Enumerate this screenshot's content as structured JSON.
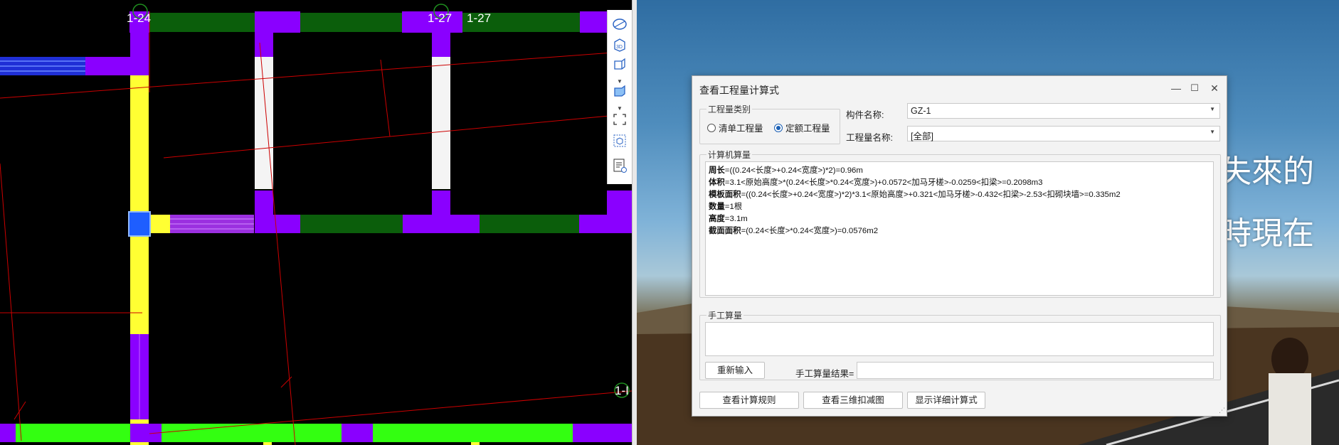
{
  "cad": {
    "axis_labels": [
      "1-24",
      "1-27",
      "1-27",
      "1-I"
    ]
  },
  "toolbar": {
    "icons": [
      "orbit-icon",
      "view-3d-icon",
      "box-view-icon",
      "box-solid-icon",
      "fit-view-icon",
      "component-icon",
      "properties-icon"
    ],
    "label_3d": "3D"
  },
  "wallpaper": {
    "text_line1": "失來的",
    "text_line2": "時現在"
  },
  "dialog": {
    "title": "查看工程量计算式",
    "window_buttons": {
      "minimize": "—",
      "maximize": "☐",
      "close": "✕"
    },
    "quantity_type": {
      "legend": "工程量类别",
      "options": [
        {
          "label": "清单工程量",
          "selected": false
        },
        {
          "label": "定额工程量",
          "selected": true
        }
      ]
    },
    "component_name": {
      "label": "构件名称:",
      "value": "GZ-1"
    },
    "quantity_name": {
      "label": "工程量名称:",
      "value": "[全部]"
    },
    "computer_calc": {
      "legend": "计算机算量",
      "lines": [
        {
          "key": "周长",
          "expr": "=((0.24<长度>+0.24<宽度>)*2)=0.96m"
        },
        {
          "key": "体积",
          "expr": "=3.1<原始高度>*(0.24<长度>*0.24<宽度>)+0.0572<加马牙槎>-0.0259<扣梁>=0.2098m3"
        },
        {
          "key": "模板面积",
          "expr": "=((0.24<长度>+0.24<宽度>)*2)*3.1<原始高度>+0.321<加马牙槎>-0.432<扣梁>-2.53<扣砌块墙>=0.335m2"
        },
        {
          "key": "数量",
          "expr": "=1根"
        },
        {
          "key": "高度",
          "expr": "=3.1m"
        },
        {
          "key": "截面面积",
          "expr": "=(0.24<长度>*0.24<宽度>)=0.0576m2"
        }
      ]
    },
    "manual_calc": {
      "legend": "手工算量",
      "reenter_button": "重新输入",
      "result_label": "手工算量结果=",
      "result_value": ""
    },
    "bottom_buttons": [
      "查看计算规则",
      "查看三维扣减图",
      "显示详细计算式"
    ]
  }
}
